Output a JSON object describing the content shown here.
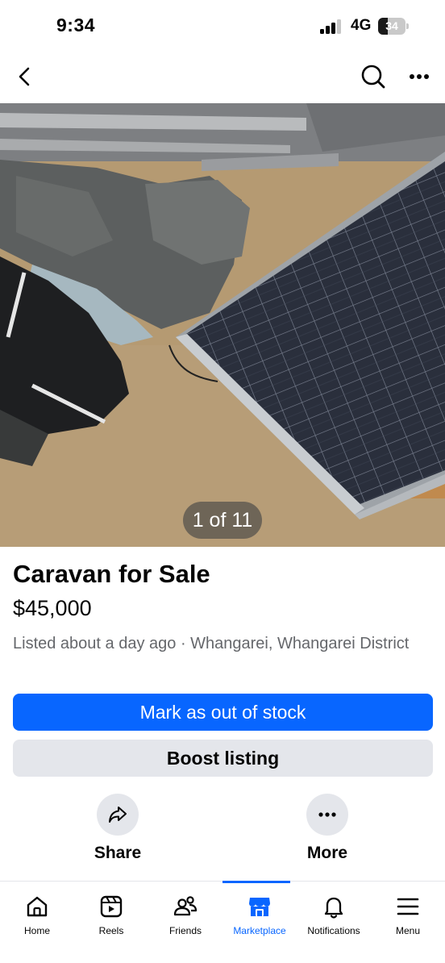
{
  "status_bar": {
    "time": "9:34",
    "network": "4G",
    "battery_level": "34",
    "battery_fraction": 0.34,
    "signal_bars_active": 3
  },
  "top_nav": {
    "back_icon": "chevron-left-icon",
    "search_icon": "search-icon",
    "more_icon": "more-horizontal-icon"
  },
  "photo": {
    "counter": "1 of 11"
  },
  "listing": {
    "title": "Caravan for Sale",
    "price": "$45,000",
    "meta": "Listed about a day ago · Whangarei, Whangarei District"
  },
  "buttons": {
    "primary": "Mark as out of stock",
    "secondary": "Boost listing"
  },
  "actions": [
    {
      "label": "Share",
      "icon": "share-arrow-icon"
    },
    {
      "label": "More",
      "icon": "more-horizontal-icon"
    }
  ],
  "tabbar": {
    "items": [
      {
        "label": "Home",
        "icon": "home-icon"
      },
      {
        "label": "Reels",
        "icon": "reels-icon"
      },
      {
        "label": "Friends",
        "icon": "friends-icon"
      },
      {
        "label": "Marketplace",
        "icon": "marketplace-icon",
        "active": true
      },
      {
        "label": "Notifications",
        "icon": "bell-icon"
      },
      {
        "label": "Menu",
        "icon": "menu-icon"
      }
    ]
  },
  "colors": {
    "accent": "#0866ff",
    "secondary_button": "#e4e6eb",
    "meta_text": "#65676b"
  }
}
